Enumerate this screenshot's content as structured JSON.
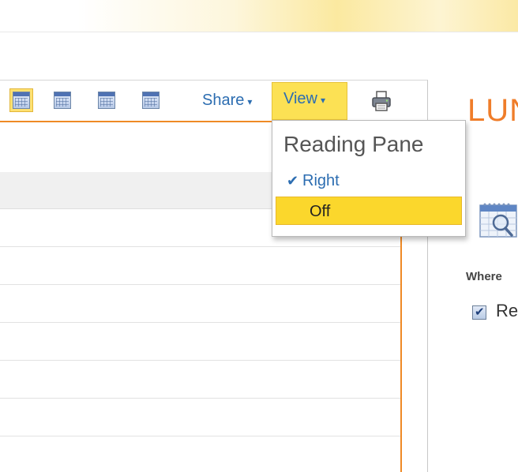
{
  "toolbar": {
    "share_label": "Share",
    "view_label": "View",
    "caret": "▾",
    "calendar_icons": [
      "calendar-day-view-icon",
      "calendar-work-week-view-icon",
      "calendar-week-view-icon",
      "calendar-month-view-icon"
    ],
    "printer_icon": "printer-icon"
  },
  "view_menu": {
    "header": "Reading Pane",
    "items": [
      {
        "label": "Right",
        "checked": true
      },
      {
        "label": "Off",
        "highlighted": true
      }
    ],
    "check_glyph": "✔"
  },
  "right_panel": {
    "title": "LUN",
    "where_label": "Where",
    "checkbox_label": "Re",
    "checkbox_checked": true,
    "icon": "calendar-magnifier-icon"
  },
  "colors": {
    "accent_orange": "#ef8a25",
    "highlight_yellow": "#fbd72c",
    "link_blue": "#2c6db1"
  }
}
